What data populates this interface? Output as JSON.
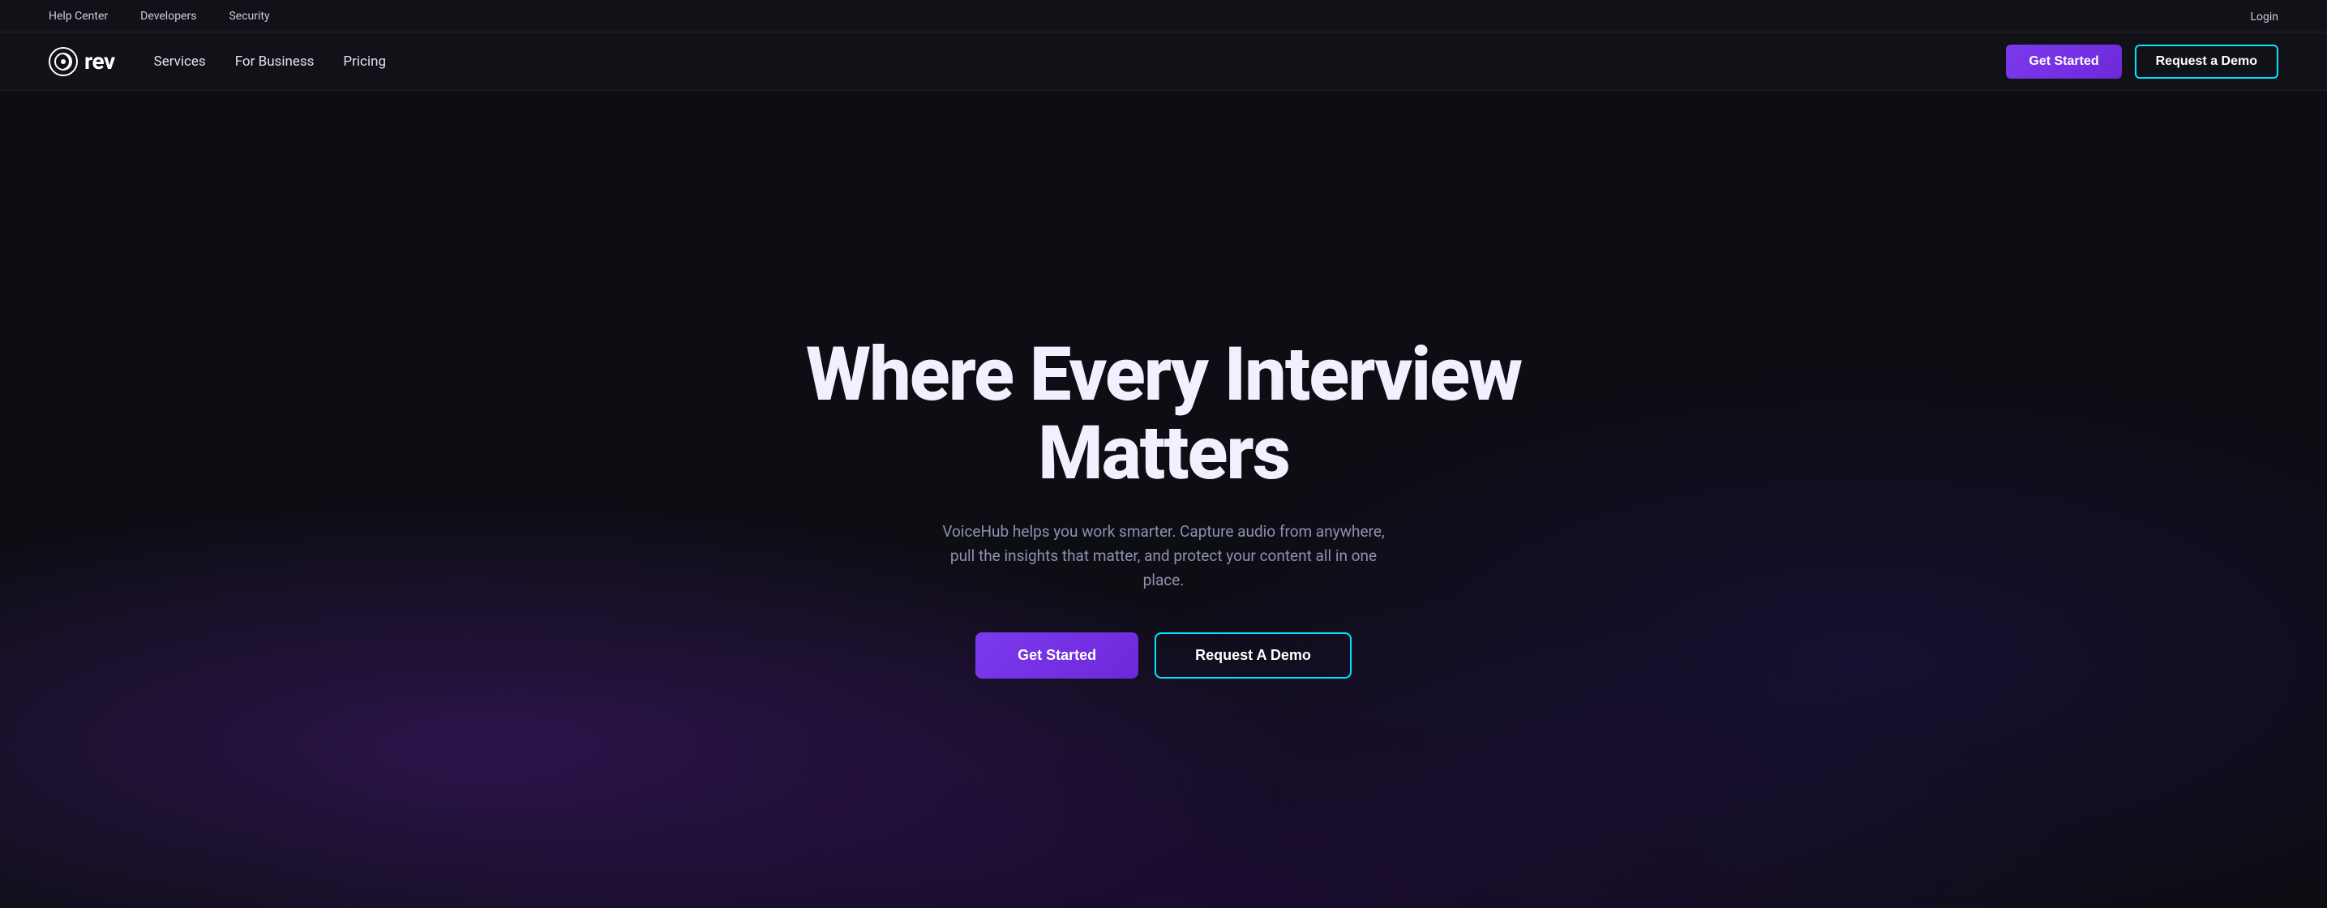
{
  "utility_bar": {
    "links": [
      {
        "id": "help-center",
        "label": "Help Center"
      },
      {
        "id": "developers",
        "label": "Developers"
      },
      {
        "id": "security",
        "label": "Security"
      }
    ],
    "login_label": "Login"
  },
  "main_nav": {
    "logo": {
      "icon_alt": "rev logo icon",
      "text": "rev"
    },
    "nav_links": [
      {
        "id": "services",
        "label": "Services"
      },
      {
        "id": "for-business",
        "label": "For Business"
      },
      {
        "id": "pricing",
        "label": "Pricing"
      }
    ],
    "get_started_label": "Get Started",
    "request_demo_label": "Request a Demo"
  },
  "hero": {
    "title": "Where Every Interview Matters",
    "subtitle": "VoiceHub helps you work smarter. Capture audio from anywhere, pull the insights that matter, and protect your content all in one place.",
    "get_started_label": "Get Started",
    "request_demo_label": "Request A Demo"
  },
  "colors": {
    "accent_purple": "#7c3aed",
    "accent_cyan": "#00e5ff",
    "bg_dark": "#0d0d14",
    "nav_bg": "#111118"
  }
}
